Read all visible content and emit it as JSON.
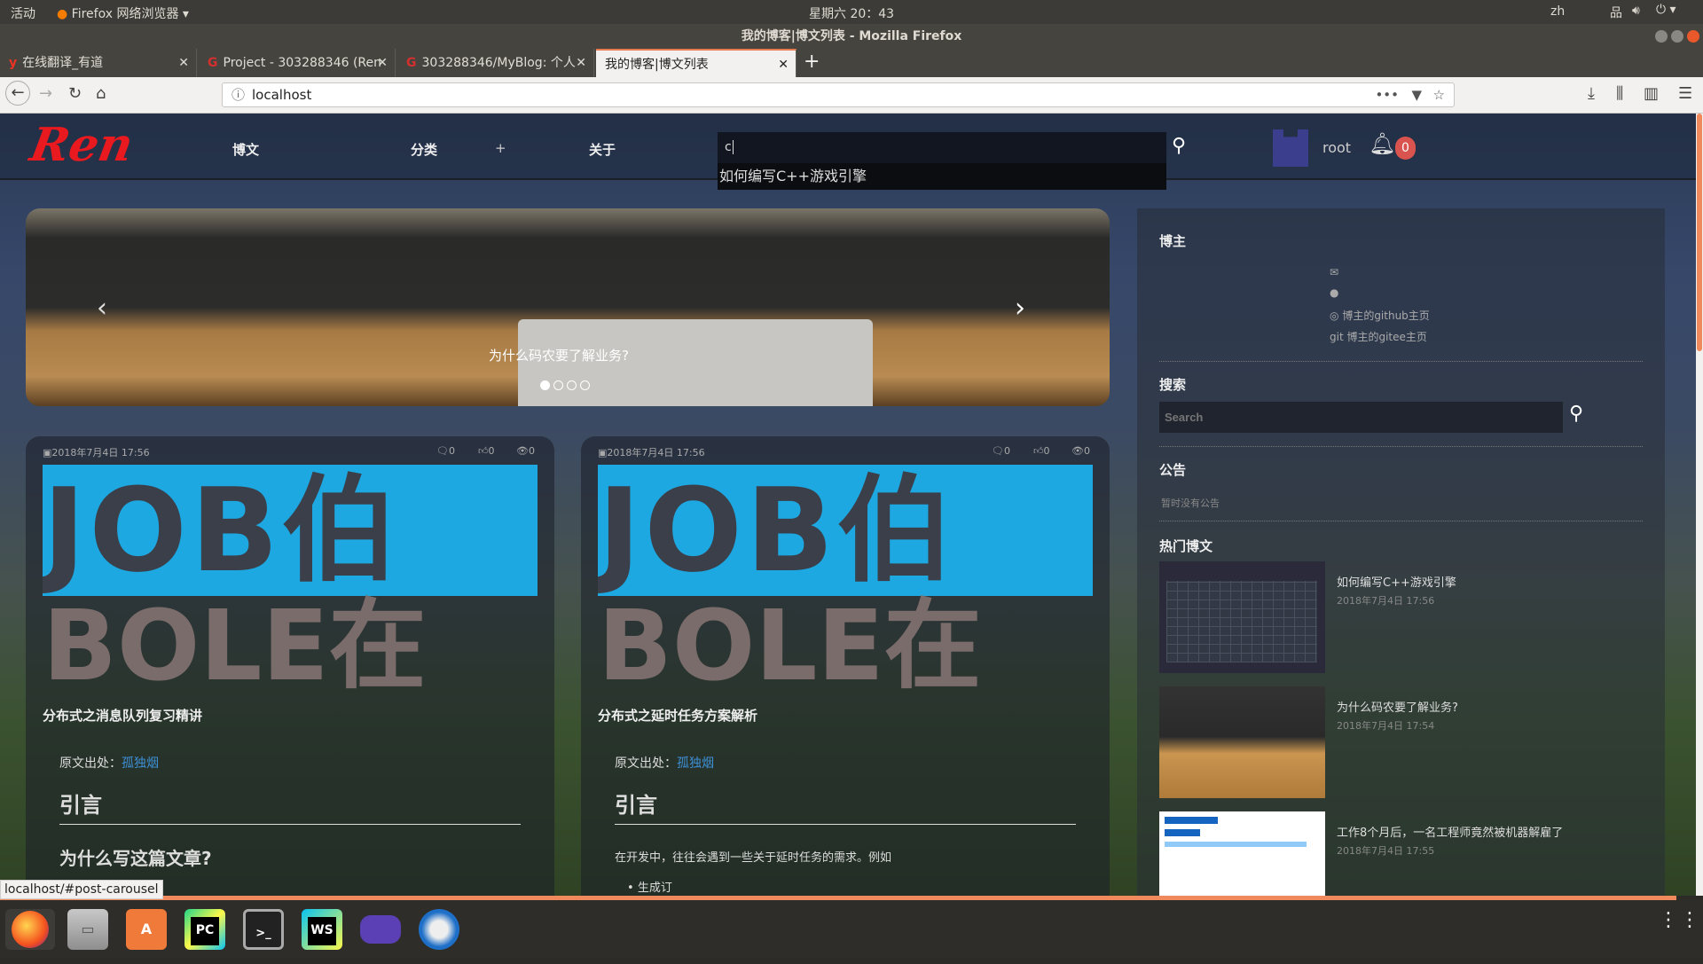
{
  "system": {
    "activities": "活动",
    "app_menu": "Firefox 网络浏览器",
    "clock": "星期六 20：43",
    "lang": "zh"
  },
  "window": {
    "title": "我的博客|博文列表 - Mozilla Firefox"
  },
  "tabs": [
    {
      "label": "在线翻译_有道"
    },
    {
      "label": "Project - 303288346 (Ren"
    },
    {
      "label": "303288346/MyBlog: 个人"
    },
    {
      "label": "我的博客|博文列表"
    }
  ],
  "url": "localhost",
  "site": {
    "logo": "Ren",
    "nav": [
      "博文",
      "分类",
      "+",
      "关于"
    ],
    "search_value": "c",
    "suggestion": "如何编写C++游戏引擎",
    "user": "root",
    "notif_count": "0"
  },
  "carousel": {
    "caption": "为什么码农要了解业务?",
    "slides": 4,
    "active": 0
  },
  "posts": [
    {
      "date": "2018年7月4日 17:56",
      "comments": "0",
      "likes": "0",
      "views": "0",
      "img_text_1": "JOB伯",
      "img_text_2": "BOLE在",
      "title": "分布式之消息队列复习精讲",
      "source_label": "原文出处：",
      "source": "孤独烟",
      "h2": "引言",
      "h3": "为什么写这篇文章?"
    },
    {
      "date": "2018年7月4日 17:56",
      "comments": "0",
      "likes": "0",
      "views": "0",
      "img_text_1": "JOB伯",
      "img_text_2": "BOLE在",
      "title": "分布式之延时任务方案解析",
      "source_label": "原文出处：",
      "source": "孤独烟",
      "h2": "引言",
      "para": "在开发中，往往会遇到一些关于延时任务的需求。例如",
      "li": "生成订"
    }
  ],
  "sidebar": {
    "blogger": "博主",
    "github": "博主的github主页",
    "gitee": "博主的gitee主页",
    "search_title": "搜索",
    "search_placeholder": "Search",
    "notice_title": "公告",
    "notice": "暂时没有公告",
    "hot_title": "热门博文",
    "hot": [
      {
        "title": "如何编写C++游戏引擎",
        "date": "2018年7月4日 17:56"
      },
      {
        "title": "为什么码农要了解业务?",
        "date": "2018年7月4日 17:54"
      },
      {
        "title": "工作8个月后，一名工程师竟然被机器解雇了",
        "date": "2018年7月4日 17:55"
      }
    ]
  },
  "status_url": "localhost/#post-carousel",
  "dock": [
    "Firefox",
    "Files",
    "Software",
    "PC",
    "Terminal",
    "WS",
    "GBA",
    "Thunderbird"
  ]
}
